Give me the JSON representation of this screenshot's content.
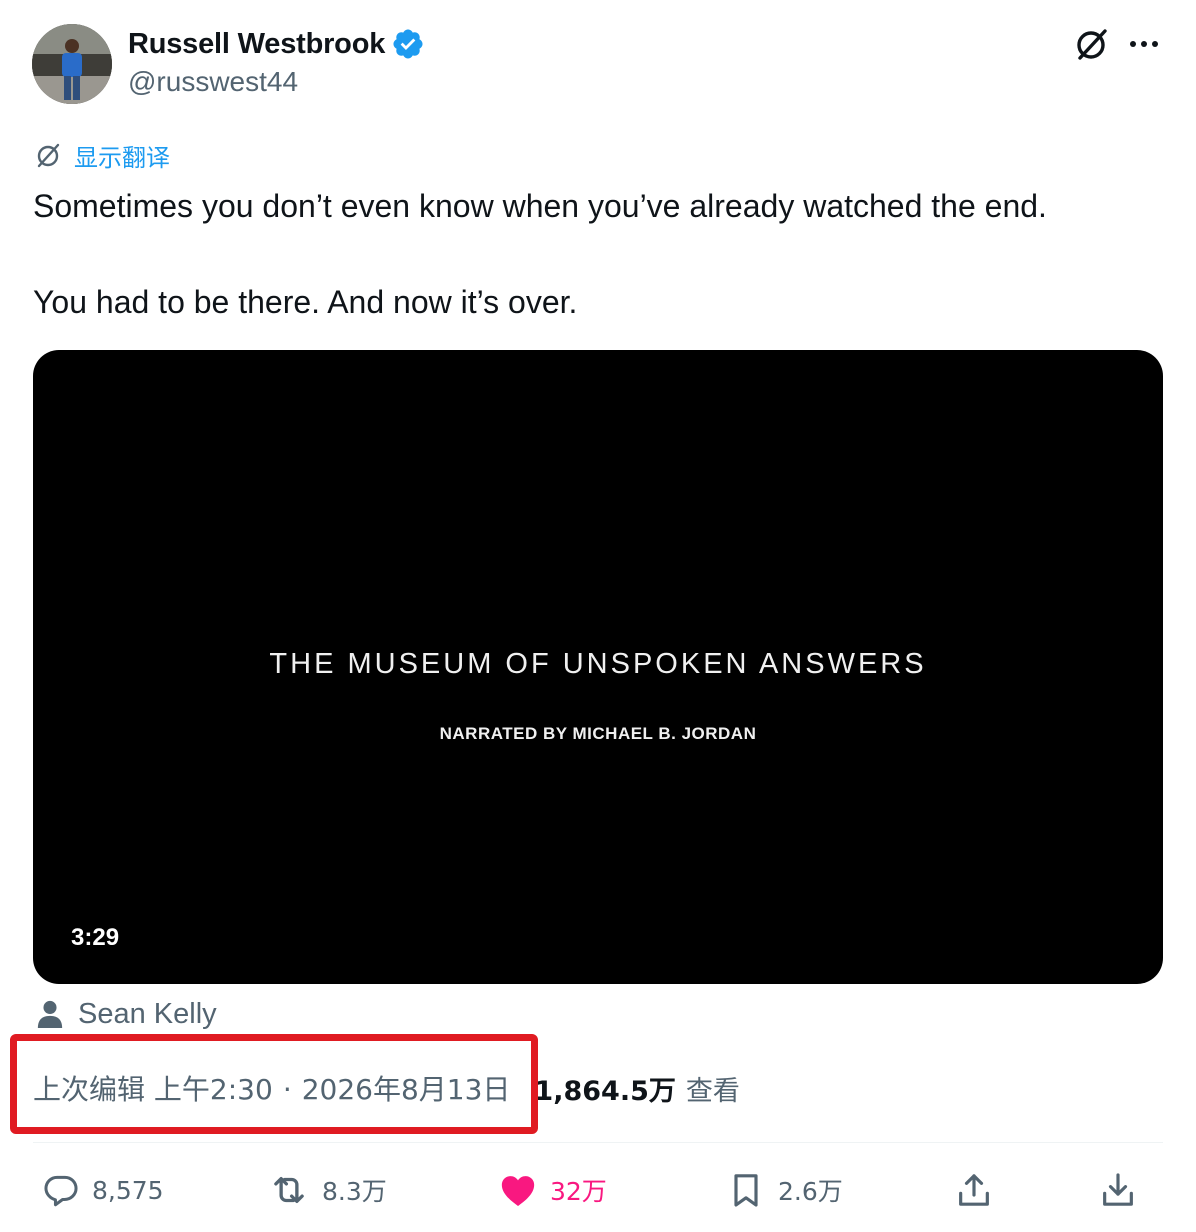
{
  "author": {
    "display_name": "Russell Westbrook",
    "handle": "@russwest44",
    "verified": true
  },
  "header_actions": {
    "grok_icon": "grok-slash-circle-icon",
    "more_icon": "more-horizontal-icon"
  },
  "translate": {
    "label": "显示翻译"
  },
  "tweet": {
    "line1": "Sometimes you don’t even know when you’ve already watched the end.",
    "line2": "You had to be there. And now it’s over."
  },
  "video": {
    "title": "THE MUSEUM OF UNSPOKEN ANSWERS",
    "subtitle": "NARRATED  BY MICHAEL B. JORDAN",
    "duration": "3:29"
  },
  "credit": {
    "name": "Sean Kelly"
  },
  "meta": {
    "edited_label": "上次编辑",
    "time": "上午2:30",
    "separator": "·",
    "date": "2026年8月13日",
    "views_count": "1,864.5万",
    "views_label": "查看"
  },
  "actions": {
    "replies": "8,575",
    "reposts": "8.3万",
    "likes": "32万",
    "bookmarks": "2.6万"
  },
  "colors": {
    "accent": "#1d9bf0",
    "like": "#f91880",
    "highlight": "#e01b22",
    "secondary_text": "#536471"
  }
}
